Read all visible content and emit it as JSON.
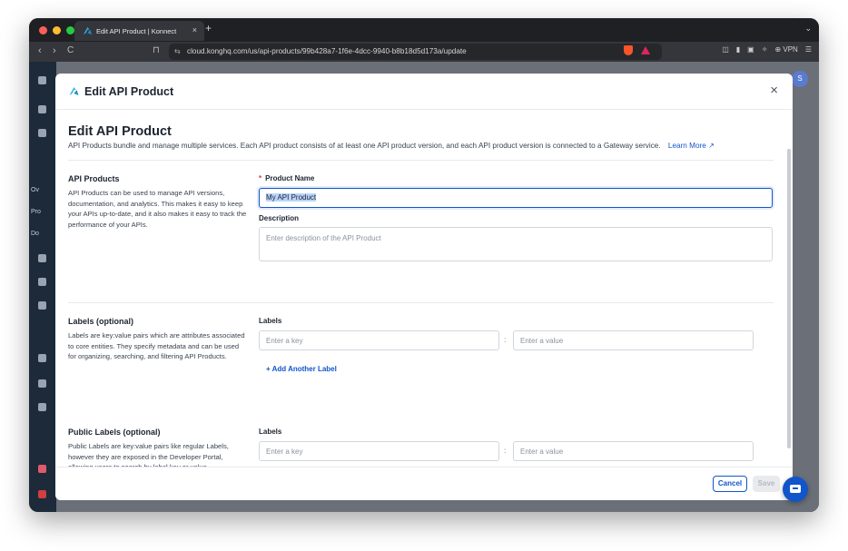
{
  "browser": {
    "tab_title": "Edit API Product | Konnect",
    "tab_close": "×",
    "new_tab": "+",
    "tab_menu": "⌄",
    "url": "cloud.konghq.com/us/api-products/99b428a7-1f6e-4dcc-9940-b8b18d5d173a/update",
    "vpn_label": "VPN",
    "back": "‹",
    "forward": "›",
    "reload": "C",
    "bookmark": "⊓"
  },
  "app": {
    "side_labels": [
      "Ov",
      "Pro",
      "Do"
    ],
    "avatar": "S"
  },
  "modal": {
    "header_title": "Edit API Product",
    "close": "×",
    "page_title": "Edit API Product",
    "subtitle": "API Products bundle and manage multiple services. Each API product consists of at least one API product version, and each API product version is connected to a Gateway service.",
    "learn_more": "Learn More ↗",
    "sections": {
      "api_products": {
        "title": "API Products",
        "description": "API Products can be used to manage API versions, documentation, and analytics. This makes it easy to keep your APIs up-to-date, and it also makes it easy to track the performance of your APIs.",
        "product_name_label": "Product Name",
        "required_mark": "*",
        "product_name_value": "My API Product",
        "description_label": "Description",
        "description_placeholder": "Enter description of the API Product"
      },
      "labels": {
        "title": "Labels (optional)",
        "description": "Labels are key:value pairs which are attributes associated to core entities. They specify metadata and can be used for organizing, searching, and filtering API Products.",
        "field_label": "Labels",
        "key_placeholder": "Enter a key",
        "separator": ":",
        "value_placeholder": "Enter a value",
        "add_label": "+ Add Another Label"
      },
      "public_labels": {
        "title": "Public Labels (optional)",
        "description": "Public Labels are key:value pairs like regular Labels, however they are exposed in the Developer Portal, allowing users to search by label key or value.",
        "field_label": "Labels",
        "key_placeholder": "Enter a key",
        "separator": ":",
        "value_placeholder": "Enter a value"
      }
    },
    "footer": {
      "cancel": "Cancel",
      "save": "Save"
    }
  },
  "colors": {
    "primary": "#1155cb",
    "required": "#d63a3a"
  }
}
